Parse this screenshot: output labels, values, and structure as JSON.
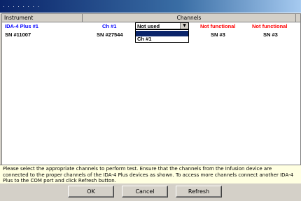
{
  "window": {
    "title": ". . . . . . . ."
  },
  "table": {
    "headers": {
      "instrument": "Instrument",
      "channels": "Channels"
    },
    "rows": [
      {
        "instrument": "IDA-4 Plus #1",
        "channel1": "Ch #1",
        "channel3": "Not functional",
        "channel4": "Not functional"
      },
      {
        "instrument": "SN #11007",
        "channel1": "SN #27544",
        "channel3": "SN #3",
        "channel4": "SN #3"
      }
    ]
  },
  "combo": {
    "value": "Not used",
    "options": [
      "",
      "Ch #1"
    ]
  },
  "info": {
    "text": "Please select the appropriate channels to perform test. Ensure that the channels from the Infusion device are connected to the proper channels of the IDA-4 Plus devices as shown. To access more channels connect another IDA-4 Plus to the COM port and click Refresh button."
  },
  "buttons": {
    "ok": "OK",
    "cancel": "Cancel",
    "refresh": "Refresh"
  },
  "colors": {
    "instrument_text": "#0000ff",
    "status_text": "#ff0000",
    "selected_option": "#0a246a"
  }
}
